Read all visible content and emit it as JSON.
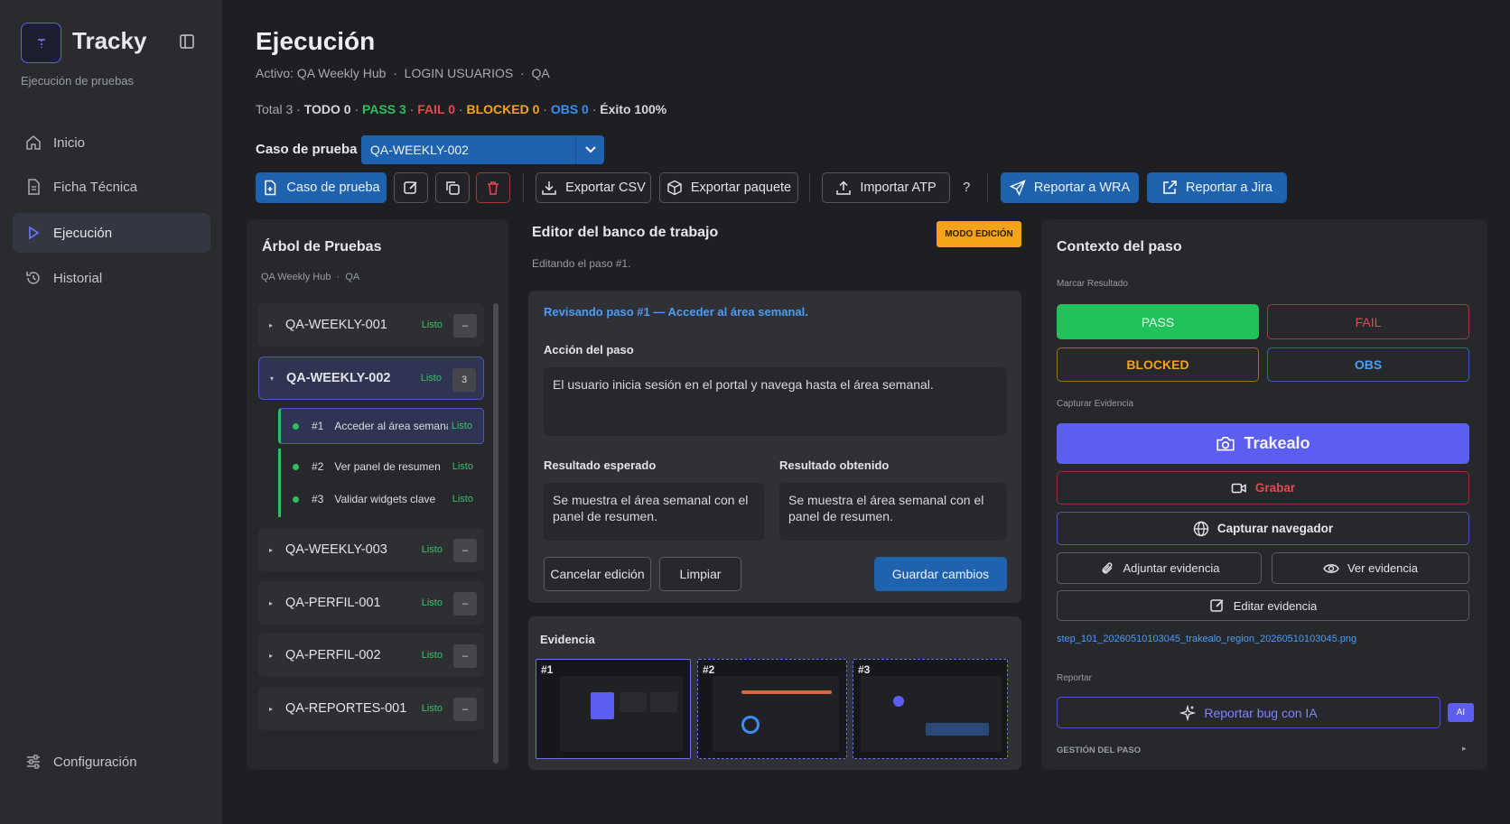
{
  "app": {
    "name": "Tracky",
    "subtitle": "Ejecución de pruebas"
  },
  "nav": [
    {
      "label": "Inicio"
    },
    {
      "label": "Ficha Técnica"
    },
    {
      "label": "Ejecución"
    },
    {
      "label": "Historial"
    }
  ],
  "settings_label": "Configuración",
  "page": {
    "title": "Ejecución",
    "crumbs": "Activo: QA Weekly Hub  ·  LOGIN USUARIOS  ·  QA"
  },
  "stats": {
    "total": "Total 3",
    "todo": "TODO 0",
    "pass": "PASS 3",
    "fail": "FAIL 0",
    "blocked": "BLOCKED 0",
    "obs": "OBS 0",
    "success": "Éxito 100%",
    "sep": " · "
  },
  "colors": {
    "pass": "#2fbf5f",
    "fail": "#e5484d",
    "blocked": "#f5a31a",
    "obs": "#3b8ef0",
    "accent": "#1f62ae",
    "violet": "#5b5ef0"
  },
  "case": {
    "label": "Caso de prueba",
    "selected": "QA-WEEKLY-002"
  },
  "toolbar": {
    "case_btn": "Caso de prueba",
    "export_csv": "Exportar CSV",
    "export_pkg": "Exportar paquete",
    "import_atp": "Importar ATP",
    "help": "?",
    "report_wra": "Reportar a WRA",
    "report_jira": "Reportar a Jira"
  },
  "tree": {
    "title": "Árbol de Pruebas",
    "crumbs": "QA Weekly Hub  ·  QA",
    "items": [
      {
        "id": "QA-WEEKLY-001",
        "status": "Listo",
        "count": "–"
      },
      {
        "id": "QA-WEEKLY-002",
        "status": "Listo",
        "count": "3"
      },
      {
        "id": "QA-WEEKLY-003",
        "status": "Listo",
        "count": "–"
      },
      {
        "id": "QA-PERFIL-001",
        "status": "Listo",
        "count": "–"
      },
      {
        "id": "QA-PERFIL-002",
        "status": "Listo",
        "count": "–"
      },
      {
        "id": "QA-REPORTES-001",
        "status": "Listo",
        "count": "–"
      }
    ],
    "steps": [
      {
        "num": "#1",
        "label": "Acceder al área semanal",
        "status": "Listo"
      },
      {
        "num": "#2",
        "label": "Ver panel de resumen",
        "status": "Listo"
      },
      {
        "num": "#3",
        "label": "Validar widgets clave",
        "status": "Listo"
      }
    ]
  },
  "editor": {
    "title": "Editor del banco de trabajo",
    "mode_badge": "MODO EDICIÓN",
    "subtitle": "Editando el paso #1.",
    "reviewing": "Revisando paso #1 — Acceder al área semanal.",
    "action_label": "Acción del paso",
    "action_text": "El usuario inicia sesión en el portal y navega hasta el área semanal.",
    "expected_label": "Resultado esperado",
    "expected_text": "Se muestra el área semanal con el panel de resumen.",
    "obtained_label": "Resultado obtenido",
    "obtained_text": "Se muestra el área semanal con el panel de resumen.",
    "cancel": "Cancelar edición",
    "clear": "Limpiar",
    "save": "Guardar cambios"
  },
  "evidence": {
    "title": "Evidencia",
    "thumbs": [
      "#1",
      "#2",
      "#3"
    ]
  },
  "context": {
    "title": "Contexto del paso",
    "mark_label": "Marcar Resultado",
    "pass": "PASS",
    "fail": "FAIL",
    "blocked": "BLOCKED",
    "obs": "OBS",
    "capture_label": "Capturar Evidencia",
    "trakealo": "Trakealo",
    "record": "Grabar",
    "capture_browser": "Capturar navegador",
    "attach": "Adjuntar evidencia",
    "view": "Ver evidencia",
    "edit": "Editar evidencia",
    "file": "step_101_20260510103045_trakealo_region_20260510103045.png",
    "report_label": "Reportar",
    "report_ai": "Reportar bug con IA",
    "ai_badge": "AI",
    "step_mgmt": "GESTIÓN DEL PASO"
  }
}
